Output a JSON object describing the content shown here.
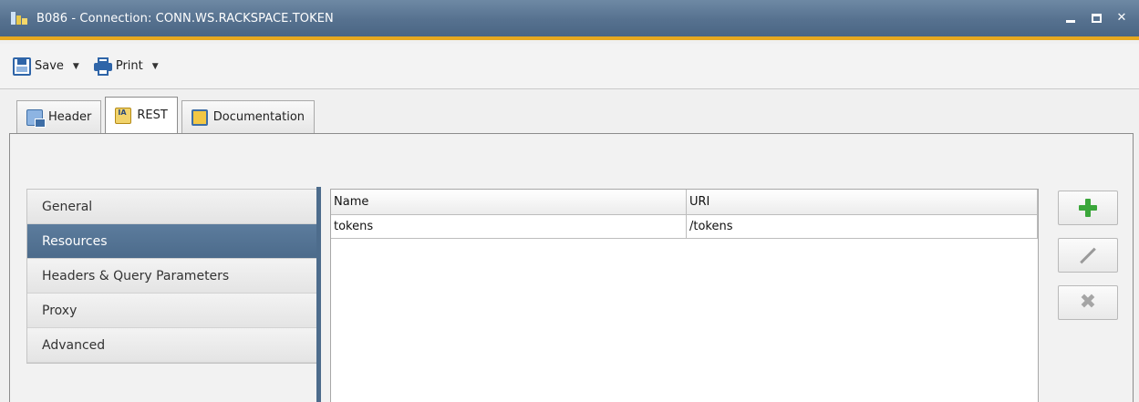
{
  "window": {
    "title": "B086 - Connection: CONN.WS.RACKSPACE.TOKEN"
  },
  "toolbar": {
    "save_label": "Save",
    "print_label": "Print"
  },
  "tabs": [
    {
      "label": "Header",
      "icon": "header-icon"
    },
    {
      "label": "REST",
      "icon": "rest-icon",
      "active": true
    },
    {
      "label": "Documentation",
      "icon": "documentation-icon"
    }
  ],
  "nav": {
    "items": [
      {
        "label": "General"
      },
      {
        "label": "Resources",
        "selected": true
      },
      {
        "label": "Headers & Query Parameters"
      },
      {
        "label": "Proxy"
      },
      {
        "label": "Advanced"
      }
    ]
  },
  "resources_table": {
    "columns": [
      "Name",
      "URI"
    ],
    "rows": [
      [
        "tokens",
        "/tokens"
      ]
    ]
  },
  "colors": {
    "titlebar": "#56718f",
    "accent": "#e7a91f",
    "nav_selected": "#4f6e8e",
    "add_green": "#3aa63a"
  }
}
